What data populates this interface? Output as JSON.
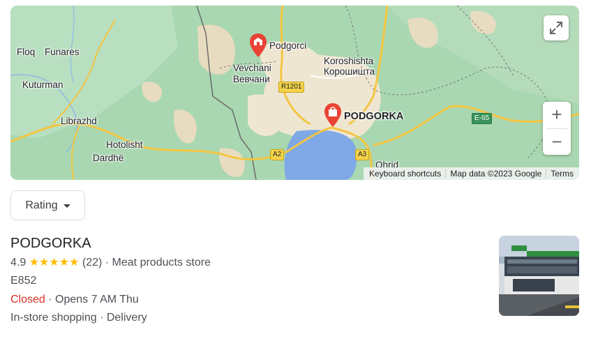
{
  "map": {
    "labels": {
      "floq": "Floq",
      "funares": "Funares",
      "kuturman": "Kuturman",
      "librazhd": "Librazhd",
      "hotolisht": "Hotolisht",
      "dardhe": "Dardhë",
      "podgorci": "Podgorci",
      "vevchani": "Vevchani",
      "vevchani_cyr": "Вевчани",
      "koroshishta": "Koroshishta",
      "koroshishta_cyr": "Корошишта",
      "podgorka": "PODGORKA",
      "ohrid": "Ohrid"
    },
    "road_shields": {
      "r1201": "R1201",
      "a2": "A2",
      "a3": "A3",
      "e65": "E-65"
    },
    "attribution": {
      "keyboard": "Keyboard shortcuts",
      "data": "Map data ©2023 Google",
      "terms": "Terms"
    },
    "icons": {
      "fullscreen": "fullscreen-icon",
      "zoom_in": "+",
      "zoom_out": "−"
    }
  },
  "filter": {
    "rating_label": "Rating"
  },
  "result": {
    "name": "PODGORKA",
    "rating": "4.9",
    "stars": "★★★★★",
    "reviews": "(22)",
    "category": "· Meat products store",
    "address": "E852",
    "status": "Closed",
    "hours": "· Opens 7 AM Thu",
    "services": "In-store shopping · Delivery"
  },
  "colors": {
    "map_green": "#a8d5b0",
    "urban": "#efe6d2",
    "water": "#7ba7e6",
    "pin_red": "#ea4335",
    "star": "#fbbc04",
    "closed": "#d93025"
  }
}
